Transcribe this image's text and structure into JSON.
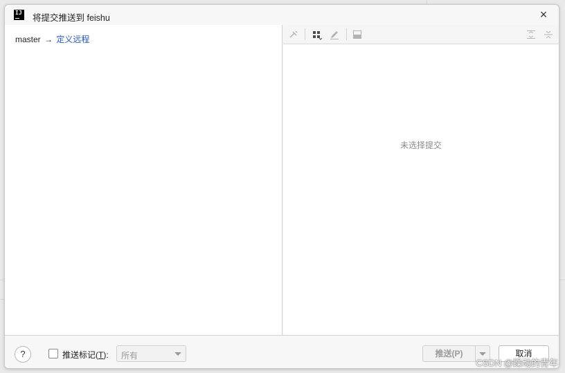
{
  "window": {
    "app_icon_text": "IJ",
    "title": "将提交推送到 feishu"
  },
  "left_pane": {
    "branch": "master",
    "arrow": "→",
    "remote_link": "定义远程"
  },
  "right_pane": {
    "empty_text": "未选择提交"
  },
  "toolbar": {
    "icons": [
      "pin-icon",
      "group-by-icon",
      "edit-icon",
      "preview-icon",
      "expand-all-icon",
      "collapse-all-icon"
    ]
  },
  "footer": {
    "help_label": "?",
    "push_tags_label_prefix": "推送标记(",
    "push_tags_mnemonic": "T",
    "push_tags_label_suffix": "):",
    "tags_select_value": "所有",
    "push_button": "推送(P)",
    "cancel_button": "取消"
  },
  "watermark": "CSDN @躁动的青年",
  "colors": {
    "link": "#2857b5",
    "disabled_text": "#9a9a9a"
  }
}
